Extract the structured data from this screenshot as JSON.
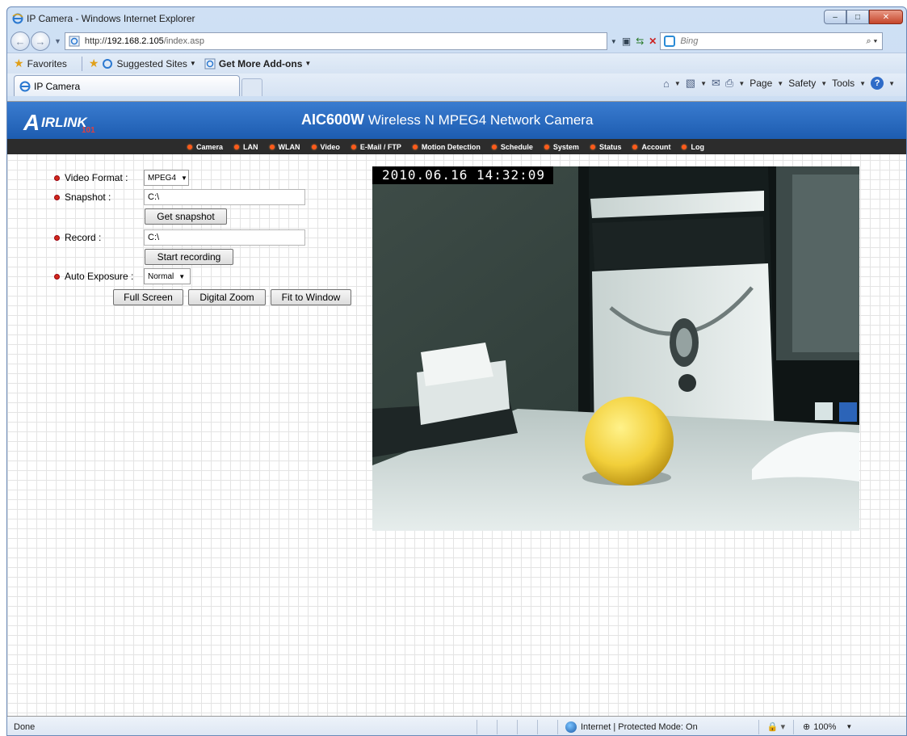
{
  "window": {
    "title": "IP Camera - Windows Internet Explorer",
    "buttons": {
      "minimize": "–",
      "maximize": "□",
      "close": "✕"
    }
  },
  "address_bar": {
    "url_scheme": "http://",
    "url_host": "192.168.2.105",
    "url_path": "/index.asp",
    "search_placeholder": "Bing"
  },
  "favorites_bar": {
    "favorites_label": "Favorites",
    "suggested_sites": "Suggested Sites",
    "get_addons": "Get More Add-ons"
  },
  "tabs": [
    {
      "label": "IP Camera",
      "active": true
    }
  ],
  "command_bar": {
    "page": "Page",
    "safety": "Safety",
    "tools": "Tools"
  },
  "banner": {
    "logo_text": "IRLINK",
    "logo_number": "101",
    "model": "AIC600W",
    "title": " Wireless N MPEG4 Network Camera"
  },
  "nav": [
    "Camera",
    "LAN",
    "WLAN",
    "Video",
    "E-Mail / FTP",
    "Motion Detection",
    "Schedule",
    "System",
    "Status",
    "Account",
    "Log"
  ],
  "controls": {
    "video_format_label": "Video Format :",
    "video_format_value": "MPEG4",
    "snapshot_label": "Snapshot :",
    "snapshot_path": "C:\\",
    "get_snapshot": "Get snapshot",
    "record_label": "Record :",
    "record_path": "C:\\",
    "start_recording": "Start recording",
    "auto_exposure_label": "Auto Exposure :",
    "auto_exposure_value": "Normal",
    "full_screen": "Full Screen",
    "digital_zoom": "Digital Zoom",
    "fit_to_window": "Fit to Window"
  },
  "video": {
    "timestamp": "2010.06.16 14:32:09"
  },
  "status_bar": {
    "status": "Done",
    "zone": "Internet | Protected Mode: On",
    "zoom": "100%"
  },
  "colors": {
    "banner_blue": "#1d5cb0",
    "nav_bg": "#2c2c2c",
    "nav_dot": "#ff5a1a",
    "bullet_red": "#d12a1a"
  }
}
